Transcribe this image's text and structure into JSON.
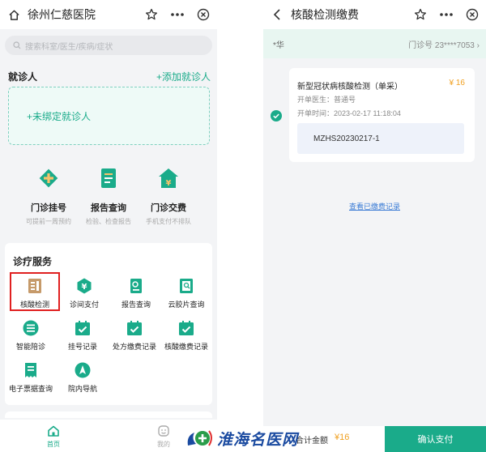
{
  "colors": {
    "primary": "#1aab8a",
    "price": "#f0a020",
    "link": "#3a7bd5",
    "highlight": "#e02020"
  },
  "left": {
    "title": "徐州仁慈医院",
    "search_placeholder": "搜索科室/医生/疾病/症状",
    "patient": {
      "label": "就诊人",
      "add": "+添加就诊人",
      "unbound": "+未绑定就诊人"
    },
    "quick": [
      {
        "label": "门诊挂号",
        "sub": "可提前一周预约",
        "icon": "registration-icon"
      },
      {
        "label": "报告查询",
        "sub": "检验、检查报告",
        "icon": "report-icon"
      },
      {
        "label": "门诊交费",
        "sub": "手机支付不排队",
        "icon": "payment-icon"
      }
    ],
    "services_title": "诊疗服务",
    "services": [
      {
        "label": "核酸检测",
        "icon": "nucleic-test-icon"
      },
      {
        "label": "诊间支付",
        "icon": "clinic-pay-icon"
      },
      {
        "label": "报告查询",
        "icon": "report-query-icon"
      },
      {
        "label": "云胶片查询",
        "icon": "cloud-film-icon"
      },
      {
        "label": "智能陪诊",
        "icon": "smart-guide-icon"
      },
      {
        "label": "挂号记录",
        "icon": "register-record-icon"
      },
      {
        "label": "处方缴费记录",
        "icon": "prescription-record-icon"
      },
      {
        "label": "核酸缴费记录",
        "icon": "nucleic-pay-record-icon"
      },
      {
        "label": "电子票据查询",
        "icon": "e-invoice-icon"
      },
      {
        "label": "院内导航",
        "icon": "navigation-icon"
      }
    ],
    "tabs": [
      {
        "label": "首页",
        "icon": "home-icon"
      },
      {
        "label": "我的",
        "icon": "profile-icon"
      }
    ]
  },
  "right": {
    "title": "核酸检测缴费",
    "patient_name": "*华",
    "outpatient_no": "门诊号 23****7053",
    "order": {
      "name": "新型冠状病核酸检测（单采）",
      "price": "¥ 16",
      "doctor": "开单医生：普通号",
      "time": "开单时间：2023-02-17 11:18:04",
      "code": "MZHS20230217-1"
    },
    "paid_link": "查看已缴费记录",
    "total_label": "合计金额",
    "total_amount": "¥16",
    "confirm": "确认支付"
  },
  "watermark": "淮海名医网"
}
